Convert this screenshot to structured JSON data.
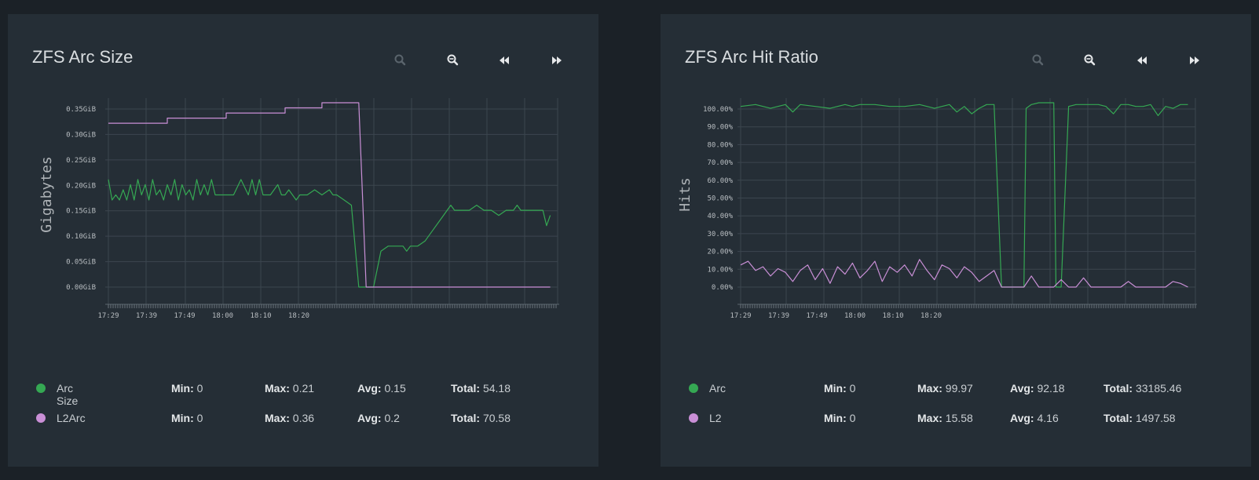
{
  "colors": {
    "green": "#35a853",
    "purple": "#c98fd6",
    "grid": "#3c464f"
  },
  "icons": {
    "zoom_in": "magnifier-icon",
    "zoom_out": "magnifier-minus-icon",
    "back": "rewind-icon",
    "forward": "fast-forward-icon"
  },
  "chart_data": [
    {
      "type": "line",
      "title": "ZFS Arc Size",
      "ylabel": "Gigabytes",
      "xlabel": "",
      "x_ticks": [
        "17:29",
        "17:39",
        "17:49",
        "18:00",
        "18:10",
        "18:20"
      ],
      "y_ticks": [
        "0.35GiB",
        "0.30GiB",
        "0.25GiB",
        "0.20GiB",
        "0.15GiB",
        "0.10GiB",
        "0.05GiB",
        "0.00GiB"
      ],
      "ylim": [
        0,
        0.36
      ],
      "xlim": [
        0,
        61
      ],
      "grid": true,
      "series": [
        {
          "name": "Arc Size",
          "color": "#35a853",
          "x": [
            0,
            0.5,
            1,
            1.5,
            2,
            2.5,
            3,
            3.5,
            4,
            4.5,
            5,
            5.5,
            6,
            6.5,
            7,
            7.5,
            8,
            8.5,
            9,
            9.5,
            10,
            10.5,
            11,
            11.5,
            12,
            12.5,
            13,
            13.5,
            14,
            14.5,
            15,
            16,
            17,
            18,
            19,
            19.5,
            20,
            20.5,
            21,
            22,
            23,
            23.5,
            24,
            24.5,
            25,
            25.5,
            26,
            27,
            28,
            29,
            30,
            30.5,
            31,
            32,
            33,
            34,
            35,
            35.5,
            36,
            37,
            38,
            38.5,
            39,
            39.5,
            40,
            40.5,
            41,
            42,
            43,
            43.5,
            44,
            45,
            45.5,
            46,
            46.5,
            47,
            48,
            49,
            50,
            51,
            52,
            53,
            54,
            55,
            55.5,
            56,
            57,
            58,
            59,
            59.5,
            60
          ],
          "y": [
            0.21,
            0.17,
            0.18,
            0.17,
            0.19,
            0.17,
            0.2,
            0.17,
            0.21,
            0.18,
            0.2,
            0.17,
            0.21,
            0.18,
            0.19,
            0.17,
            0.2,
            0.18,
            0.21,
            0.17,
            0.2,
            0.18,
            0.19,
            0.17,
            0.21,
            0.18,
            0.2,
            0.18,
            0.21,
            0.18,
            0.18,
            0.18,
            0.18,
            0.21,
            0.18,
            0.21,
            0.18,
            0.21,
            0.18,
            0.18,
            0.2,
            0.18,
            0.18,
            0.19,
            0.18,
            0.17,
            0.18,
            0.18,
            0.19,
            0.18,
            0.19,
            0.18,
            0.18,
            0.17,
            0.16,
            0.0,
            0.0,
            0.0,
            0.0,
            0.07,
            0.08,
            0.08,
            0.08,
            0.08,
            0.08,
            0.07,
            0.08,
            0.08,
            0.09,
            0.1,
            0.11,
            0.13,
            0.14,
            0.15,
            0.16,
            0.15,
            0.15,
            0.15,
            0.16,
            0.15,
            0.15,
            0.14,
            0.15,
            0.15,
            0.16,
            0.15,
            0.15,
            0.15,
            0.15,
            0.12,
            0.14
          ]
        },
        {
          "name": "L2Arc",
          "color": "#c98fd6",
          "x": [
            0,
            8,
            8,
            16,
            16,
            24,
            24,
            29,
            29,
            34,
            34,
            35,
            36,
            50,
            60
          ],
          "y": [
            0.32,
            0.32,
            0.33,
            0.33,
            0.34,
            0.34,
            0.35,
            0.35,
            0.36,
            0.36,
            0.36,
            0.0,
            0.0,
            0.0,
            0.0
          ]
        }
      ],
      "legend": [
        {
          "name": "Arc Size",
          "min": "0",
          "max": "0.21",
          "avg": "0.15",
          "total": "54.18"
        },
        {
          "name": "L2Arc",
          "min": "0",
          "max": "0.36",
          "avg": "0.2",
          "total": "70.58"
        }
      ]
    },
    {
      "type": "line",
      "title": "ZFS Arc Hit Ratio",
      "ylabel": "Hits",
      "xlabel": "",
      "x_ticks": [
        "17:29",
        "17:39",
        "17:49",
        "18:00",
        "18:10",
        "18:20"
      ],
      "y_ticks": [
        "100.00%",
        "90.00%",
        "80.00%",
        "70.00%",
        "60.00%",
        "50.00%",
        "40.00%",
        "30.00%",
        "20.00%",
        "10.00%",
        "0.00%"
      ],
      "ylim": [
        0,
        100
      ],
      "xlim": [
        0,
        61
      ],
      "grid": true,
      "series": [
        {
          "name": "Arc",
          "color": "#35a853",
          "x": [
            0,
            2,
            4,
            6,
            7,
            8,
            10,
            12,
            14,
            15,
            16,
            18,
            20,
            22,
            24,
            26,
            28,
            29,
            30,
            31,
            32,
            33,
            34,
            35,
            35.5,
            36,
            37,
            38,
            38.3,
            39,
            40,
            41,
            42,
            42.3,
            43,
            44,
            45,
            46,
            47,
            48,
            49,
            50,
            51,
            52,
            53,
            54,
            55,
            56,
            57,
            58,
            59,
            60
          ],
          "y": [
            98,
            99,
            97,
            99,
            95,
            99,
            98,
            97,
            99,
            98,
            99,
            99,
            98,
            98,
            99,
            97,
            99,
            95,
            98,
            94,
            97,
            99,
            99,
            0,
            0,
            0,
            0,
            0,
            97,
            99,
            100,
            100,
            100,
            0,
            0,
            98,
            99,
            99,
            99,
            99,
            98,
            94,
            99,
            99,
            98,
            98,
            99,
            93,
            98,
            97,
            99,
            99
          ]
        },
        {
          "name": "L2",
          "color": "#c98fd6",
          "x": [
            0,
            1,
            2,
            3,
            4,
            5,
            6,
            7,
            8,
            9,
            10,
            11,
            12,
            13,
            14,
            15,
            16,
            17,
            18,
            19,
            20,
            21,
            22,
            23,
            24,
            25,
            26,
            27,
            28,
            29,
            30,
            31,
            32,
            33,
            34,
            35,
            36,
            37,
            38,
            39,
            40,
            41,
            42,
            43,
            44,
            45,
            46,
            47,
            48,
            49,
            50,
            51,
            52,
            53,
            54,
            55,
            56,
            57,
            58,
            59,
            60
          ],
          "y": [
            12,
            14,
            9,
            11,
            6,
            10,
            8,
            3,
            9,
            12,
            4,
            10,
            2,
            11,
            7,
            13,
            5,
            9,
            14,
            3,
            11,
            8,
            12,
            6,
            15,
            9,
            4,
            12,
            10,
            5,
            11,
            8,
            3,
            6,
            9,
            0,
            0,
            0,
            0,
            6,
            0,
            0,
            0,
            4,
            0,
            0,
            5,
            0,
            0,
            0,
            0,
            0,
            3,
            0,
            0,
            0,
            0,
            0,
            3,
            2,
            0
          ]
        }
      ],
      "legend": [
        {
          "name": "Arc",
          "min": "0",
          "max": "99.97",
          "avg": "92.18",
          "total": "33185.46"
        },
        {
          "name": "L2",
          "min": "0",
          "max": "15.58",
          "avg": "4.16",
          "total": "1497.58"
        }
      ]
    }
  ],
  "labels": {
    "min": "Min:",
    "max": "Max:",
    "avg": "Avg:",
    "total": "Total:"
  }
}
